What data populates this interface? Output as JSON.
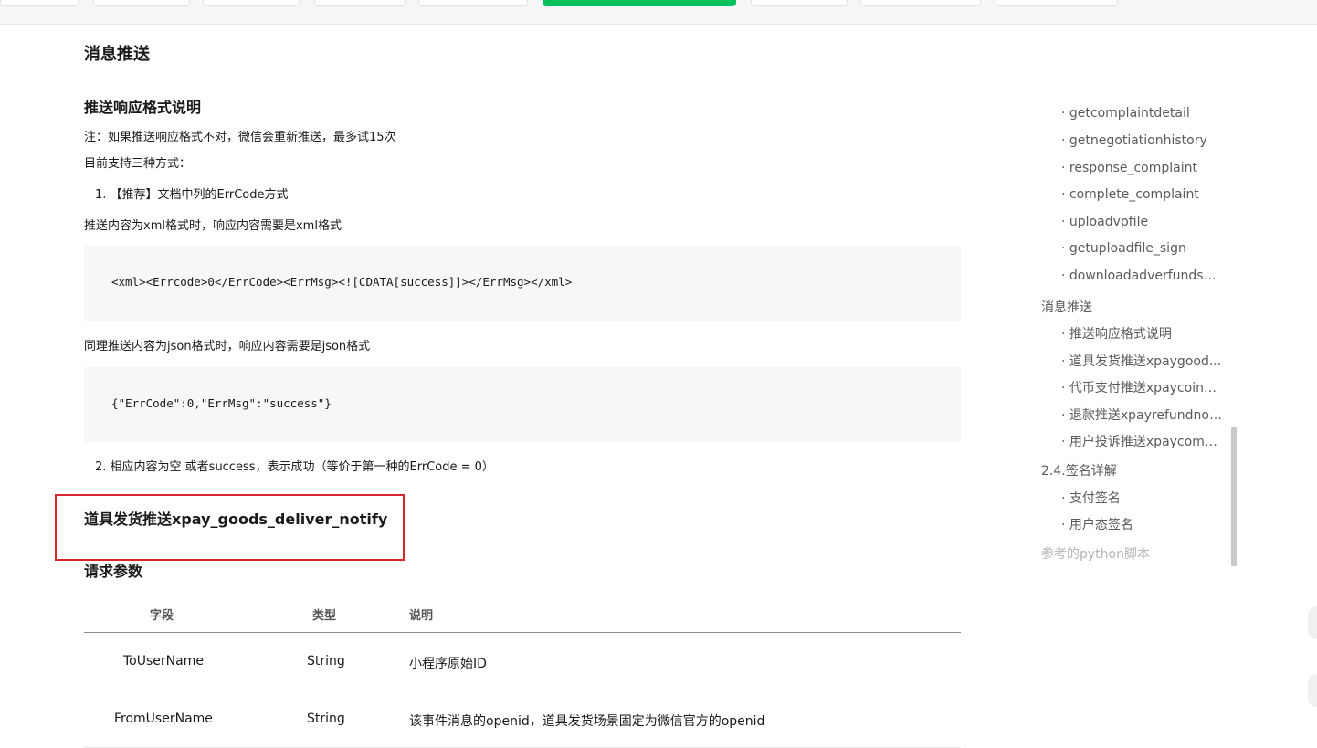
{
  "page": {
    "section_title": "消息推送",
    "subsection_title": "推送响应格式说明",
    "note": "注：如果推送响应格式不对，微信会重新推送，最多试15次",
    "supported": "目前支持三种方式：",
    "item1": "1. 【推荐】文档中列的ErrCode方式",
    "xml_desc": "推送内容为xml格式时，响应内容需要是xml格式",
    "xml_code": "<xml><Errcode>0</ErrCode><ErrMsg><![CDATA[success]]></ErrMsg></xml>",
    "json_desc": "同理推送内容为json格式时，响应内容需要是json格式",
    "json_code": "{\"ErrCode\":0,\"ErrMsg\":\"success\"}",
    "item2": "2. 相应内容为空 或者success，表示成功（等价于第一种的ErrCode = 0）",
    "goods_title": "道具发货推送xpay_goods_deliver_notify",
    "request_params": "请求参数"
  },
  "table": {
    "headers": [
      "字段",
      "类型",
      "说明"
    ],
    "rows": [
      {
        "field": "ToUserName",
        "type": "String",
        "desc": "小程序原始ID"
      },
      {
        "field": "FromUserName",
        "type": "String",
        "desc": "该事件消息的openid，道具发货场景固定为微信官方的openid"
      }
    ]
  },
  "toc": [
    "· getcomplaintdetail",
    "· getnegotiationhistory",
    "· response_complaint",
    "· complete_complaint",
    "· uploadvpfile",
    "· getuploadfile_sign",
    "· downloadadverfundsor...",
    "消息推送",
    "· 推送响应格式说明",
    "· 道具发货推送xpaygood...",
    "· 代币支付推送xpaycoinp...",
    "· 退款推送xpayrefundnot...",
    "· 用户投诉推送xpaycomp...",
    "2.4.签名详解",
    "· 支付签名",
    "· 用户态签名",
    "参考的python脚本"
  ],
  "colors": {
    "accent": "#07c160",
    "highlight": "#d9262b"
  }
}
